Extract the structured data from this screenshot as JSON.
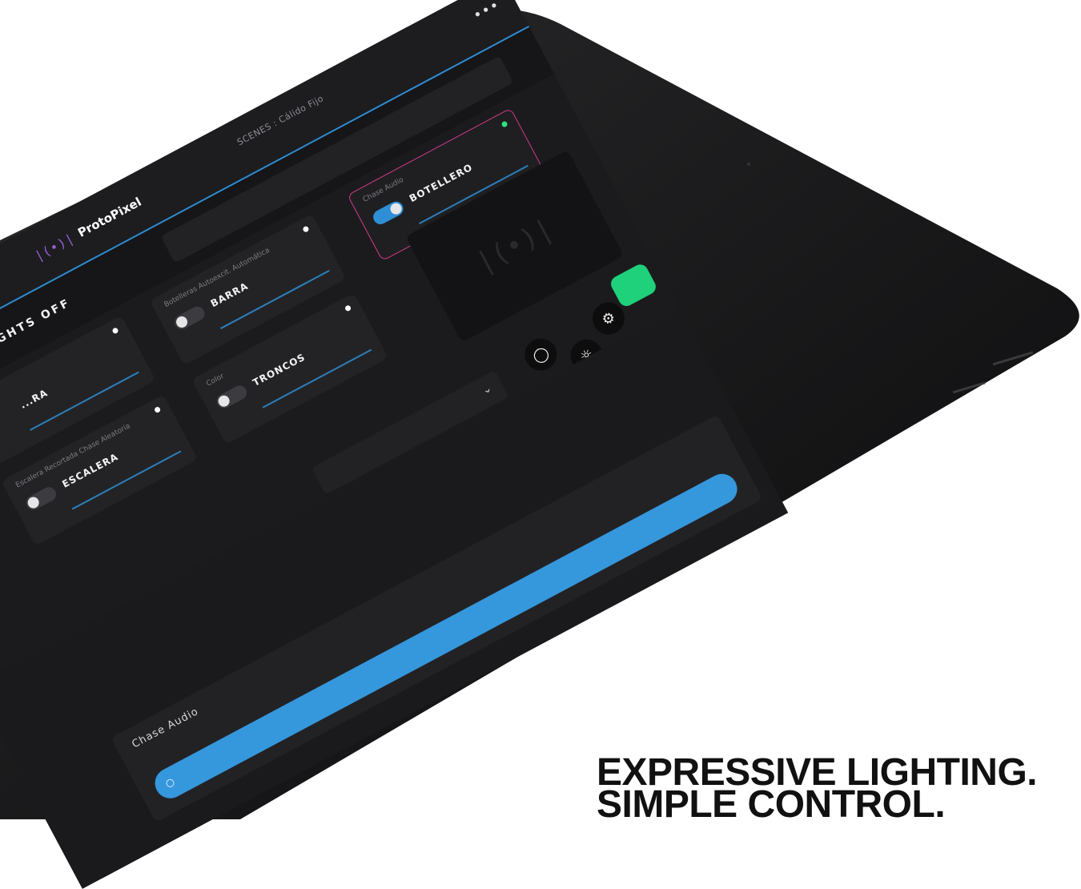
{
  "app": {
    "logo_mark": "|(•)|",
    "logo_text": "ProtoPixel",
    "header_title": "SCENES : Cálido Fijo",
    "more_icon": "more-horizontal-icon"
  },
  "subbar": {
    "lights_off_label": "LIGHTS OFF"
  },
  "zones": [
    {
      "name": "BOTELLERO",
      "mode": "Chase Audio",
      "on": true,
      "active": true
    },
    {
      "name": "BARRA",
      "mode": "Botelleras Autoexcit. Automática",
      "on": false,
      "active": false
    },
    {
      "name": "TRONCOS",
      "mode": "Color",
      "on": false,
      "active": false
    },
    {
      "name": "ESCALERA",
      "mode": "Escalera Recortada Chase Aleatoria",
      "on": false,
      "active": false
    },
    {
      "name": "...RA",
      "mode": "",
      "on": false,
      "active": false
    }
  ],
  "toolbar": {
    "icons": [
      "circle-icon",
      "brightness-icon",
      "sliders-icon"
    ],
    "green_button_color": "#1fd17a"
  },
  "dropdown": {
    "chevron": "chevron-down-icon"
  },
  "audio": {
    "label": "Chase Audio",
    "level_percent": 100
  },
  "colors": {
    "accent_blue": "#2e8fd6",
    "active_border": "#d43a8a",
    "status_green": "#2ee47a",
    "screen_bg": "#1b1b1d"
  },
  "tagline": {
    "line1": "EXPRESSIVE LIGHTING.",
    "line2": "SIMPLE CONTROL."
  }
}
